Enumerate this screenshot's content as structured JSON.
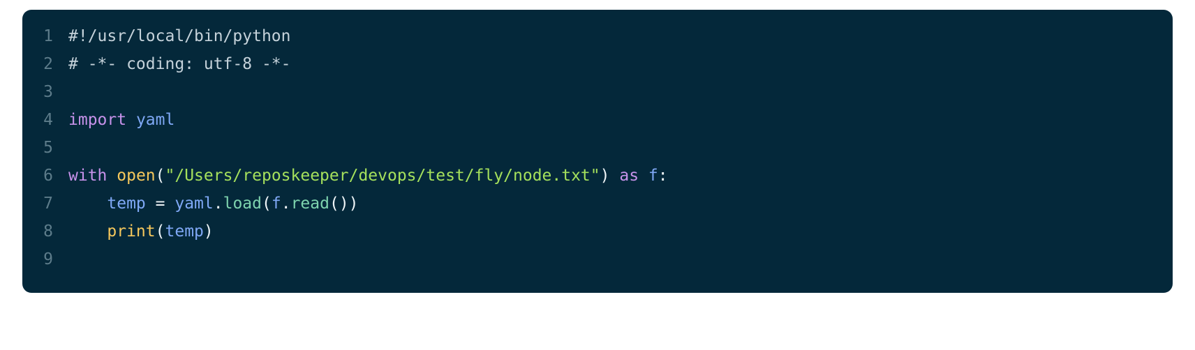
{
  "editor": {
    "background_color": "#04283a",
    "page_background_color": "#ffffff",
    "gutter_color": "#5d7c8a",
    "language": "python",
    "total_lines": 9,
    "line_numbers": [
      "1",
      "2",
      "3",
      "4",
      "5",
      "6",
      "7",
      "8",
      "9"
    ],
    "palette": {
      "comment": "#c5d2da",
      "keyword": "#c792ea",
      "builtin": "#f6c85c",
      "string": "#a5e05c",
      "variable": "#7fa8f5",
      "method": "#7ed3ae",
      "punctuation": "#eef4f7"
    },
    "lines": [
      {
        "number": "1",
        "text": "#!/usr/local/bin/python",
        "tokens": [
          {
            "t": "#!/usr/local/bin/python",
            "c": "comment"
          }
        ]
      },
      {
        "number": "2",
        "text": "# -*- coding: utf-8 -*-",
        "tokens": [
          {
            "t": "# -*- coding: utf-8 -*-",
            "c": "comment"
          }
        ]
      },
      {
        "number": "3",
        "text": "",
        "tokens": []
      },
      {
        "number": "4",
        "text": "import yaml",
        "tokens": [
          {
            "t": "import",
            "c": "keyword"
          },
          {
            "t": " ",
            "c": "plain"
          },
          {
            "t": "yaml",
            "c": "variable"
          }
        ]
      },
      {
        "number": "5",
        "text": "",
        "tokens": []
      },
      {
        "number": "6",
        "text": "with open(\"/Users/reposkeeper/devops/test/fly/node.txt\") as f:",
        "tokens": [
          {
            "t": "with",
            "c": "keyword"
          },
          {
            "t": " ",
            "c": "plain"
          },
          {
            "t": "open",
            "c": "builtin"
          },
          {
            "t": "(",
            "c": "punct"
          },
          {
            "t": "\"/Users/reposkeeper/devops/test/fly/node.txt\"",
            "c": "string"
          },
          {
            "t": ")",
            "c": "punct"
          },
          {
            "t": " ",
            "c": "plain"
          },
          {
            "t": "as",
            "c": "keyword"
          },
          {
            "t": " ",
            "c": "plain"
          },
          {
            "t": "f",
            "c": "variable"
          },
          {
            "t": ":",
            "c": "punct"
          }
        ]
      },
      {
        "number": "7",
        "text": "    temp = yaml.load(f.read())",
        "tokens": [
          {
            "t": "    ",
            "c": "plain"
          },
          {
            "t": "temp",
            "c": "variable"
          },
          {
            "t": " ",
            "c": "plain"
          },
          {
            "t": "=",
            "c": "operator"
          },
          {
            "t": " ",
            "c": "plain"
          },
          {
            "t": "yaml",
            "c": "variable"
          },
          {
            "t": ".",
            "c": "punct"
          },
          {
            "t": "load",
            "c": "method"
          },
          {
            "t": "(",
            "c": "punct"
          },
          {
            "t": "f",
            "c": "variable"
          },
          {
            "t": ".",
            "c": "punct"
          },
          {
            "t": "read",
            "c": "method"
          },
          {
            "t": "()",
            "c": "punct"
          },
          {
            "t": ")",
            "c": "punct"
          }
        ]
      },
      {
        "number": "8",
        "text": "    print(temp)",
        "tokens": [
          {
            "t": "    ",
            "c": "plain"
          },
          {
            "t": "print",
            "c": "builtin"
          },
          {
            "t": "(",
            "c": "punct"
          },
          {
            "t": "temp",
            "c": "variable"
          },
          {
            "t": ")",
            "c": "punct"
          }
        ]
      },
      {
        "number": "9",
        "text": "",
        "tokens": []
      }
    ]
  }
}
